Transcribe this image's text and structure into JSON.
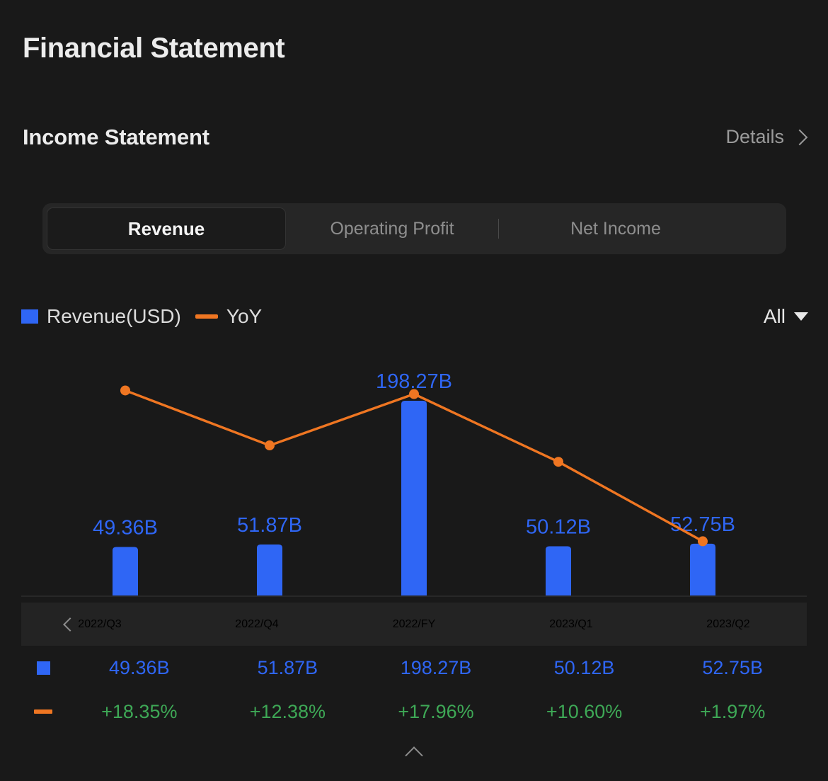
{
  "header": {
    "title": "Financial Statement",
    "section_title": "Income Statement",
    "details_label": "Details",
    "details_icon": "chevron-right-icon"
  },
  "tabs": [
    {
      "label": "Revenue",
      "active": true
    },
    {
      "label": "Operating Profit",
      "active": false
    },
    {
      "label": "Net Income",
      "active": false
    }
  ],
  "legend": {
    "bar_label": "Revenue(USD)",
    "line_label": "YoY",
    "bar_color": "#2f66f5",
    "line_color": "#ef7622",
    "range_value": "All",
    "range_icon": "caret-down-icon"
  },
  "table": {
    "prev_icon": "chevron-left-icon",
    "collapse_icon": "chevron-up-icon",
    "periods": [
      "2022/Q3",
      "2022/Q4",
      "2022/FY",
      "2023/Q1",
      "2023/Q2"
    ],
    "revenue_values": [
      "49.36B",
      "51.87B",
      "198.27B",
      "50.12B",
      "52.75B"
    ],
    "yoy_values": [
      "+18.35%",
      "+12.38%",
      "+17.96%",
      "+10.60%",
      "+1.97%"
    ],
    "value_color": "#2f66f5",
    "yoy_color": "#3ea856"
  },
  "chart_data": {
    "type": "bar",
    "title": "",
    "xlabel": "",
    "ylabel": "",
    "categories": [
      "2022/Q3",
      "2022/Q4",
      "2022/FY",
      "2023/Q1",
      "2023/Q2"
    ],
    "series": [
      {
        "name": "Revenue(USD)",
        "type": "bar",
        "color": "#2f66f5",
        "unit": "B USD",
        "values": [
          49.36,
          51.87,
          198.27,
          50.12,
          52.75
        ],
        "labels": [
          "49.36B",
          "51.87B",
          "198.27B",
          "50.12B",
          "52.75B"
        ]
      },
      {
        "name": "YoY",
        "type": "line",
        "color": "#ef7622",
        "unit": "%",
        "values": [
          18.35,
          12.38,
          17.96,
          10.6,
          1.97
        ],
        "labels": [
          "+18.35%",
          "+12.38%",
          "+17.96%",
          "+10.60%",
          "+1.97%"
        ]
      }
    ],
    "grid": false,
    "legend_position": "top-left",
    "bar_ylim": [
      0,
      198.27
    ],
    "line_ylim": [
      0,
      20
    ]
  }
}
